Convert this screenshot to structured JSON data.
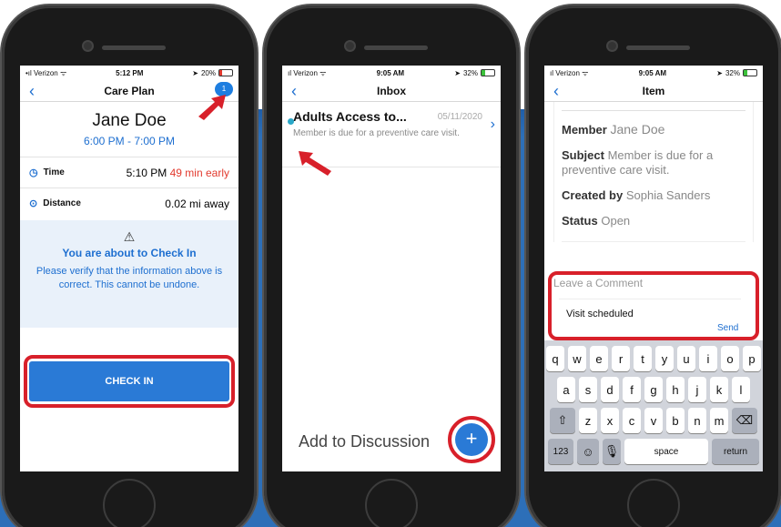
{
  "phone1": {
    "status": {
      "carrier": "Verizon",
      "time": "5:12 PM",
      "battery": "20%"
    },
    "nav_title": "Care Plan",
    "badge_count": "1",
    "member_name": "Jane Doe",
    "time_range": "6:00 PM - 7:00 PM",
    "time_label": "Time",
    "time_value": "5:10 PM",
    "time_early": "49 min early",
    "distance_label": "Distance",
    "distance_value": "0.02 mi away",
    "alert_title": "You are about to Check In",
    "alert_body": "Please verify that the information above is correct. This cannot be undone.",
    "checkin_label": "CHECK IN"
  },
  "phone2": {
    "status": {
      "carrier": "Verizon",
      "time": "9:05 AM",
      "battery": "32%"
    },
    "nav_title": "Inbox",
    "message": {
      "subject": "Adults Access to...",
      "date": "05/11/2020",
      "preview": "Member is due for a preventive care visit."
    },
    "add_label": "Add to Discussion",
    "fab_label": "+"
  },
  "phone3": {
    "status": {
      "carrier": "Verizon",
      "time": "9:05 AM",
      "battery": "32%"
    },
    "nav_title": "Item",
    "fields": [
      {
        "label": "Member",
        "value": "Jane Doe"
      },
      {
        "label": "Subject",
        "value": "Member is due for a preventive care visit."
      },
      {
        "label": "Created by",
        "value": "Sophia Sanders"
      },
      {
        "label": "Status",
        "value": "Open"
      }
    ],
    "comment_placeholder": "Leave a Comment",
    "comment_text": "Visit scheduled",
    "send_label": "Send",
    "keyboard": {
      "row1": [
        "q",
        "w",
        "e",
        "r",
        "t",
        "y",
        "u",
        "i",
        "o",
        "p"
      ],
      "row2": [
        "a",
        "s",
        "d",
        "f",
        "g",
        "h",
        "j",
        "k",
        "l"
      ],
      "row3": [
        "z",
        "x",
        "c",
        "v",
        "b",
        "n",
        "m"
      ],
      "numbers_key": "123",
      "space_key": "space",
      "return_key": "return"
    }
  },
  "colors": {
    "accent": "#1e6fd0",
    "highlight_ring": "#d8202a",
    "background_band": "#2d6fb8"
  }
}
